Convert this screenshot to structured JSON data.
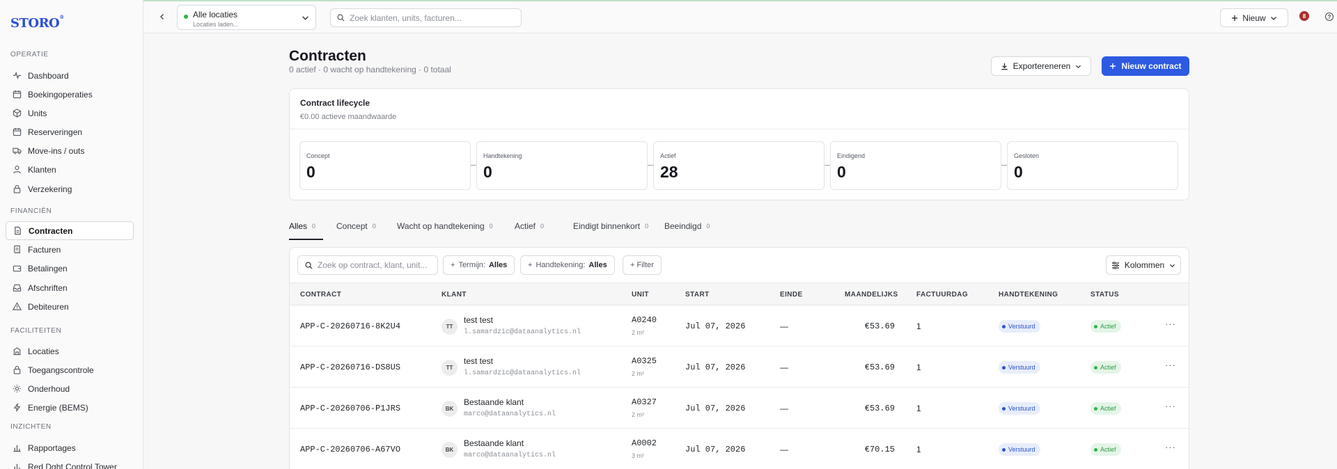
{
  "app": {
    "logo": "STORO",
    "logo_mark": "®"
  },
  "sidebar": {
    "sections": [
      {
        "title": "OPERATIE",
        "items": [
          {
            "label": "Dashboard",
            "icon": "activity-icon"
          },
          {
            "label": "Boekingoperaties",
            "icon": "calendar-icon"
          },
          {
            "label": "Units",
            "icon": "box-icon"
          },
          {
            "label": "Reserveringen",
            "icon": "calendar-icon"
          },
          {
            "label": "Move-ins / outs",
            "icon": "truck-icon"
          },
          {
            "label": "Klanten",
            "icon": "user-icon"
          },
          {
            "label": "Verzekering",
            "icon": "lock-icon"
          }
        ]
      },
      {
        "title": "FINANCIËN",
        "items": [
          {
            "label": "Contracten",
            "icon": "document-icon",
            "active": true
          },
          {
            "label": "Facturen",
            "icon": "receipt-icon"
          },
          {
            "label": "Betalingen",
            "icon": "wallet-icon"
          },
          {
            "label": "Afschriften",
            "icon": "inbox-icon"
          },
          {
            "label": "Debiteuren",
            "icon": "warning-icon"
          }
        ]
      },
      {
        "title": "FACILITEITEN",
        "items": [
          {
            "label": "Locaties",
            "icon": "building-icon"
          },
          {
            "label": "Toegangscontrole",
            "icon": "lock-icon"
          },
          {
            "label": "Onderhoud",
            "icon": "sun-icon"
          },
          {
            "label": "Energie (BEMS)",
            "icon": "bolt-icon"
          }
        ]
      },
      {
        "title": "INZICHTEN",
        "items": [
          {
            "label": "Rapportages",
            "icon": "chart-icon"
          },
          {
            "label": "Red Dght Control Tower",
            "icon": "chart-icon"
          }
        ]
      }
    ]
  },
  "topbar": {
    "location_title": "Alle locaties",
    "location_sub": "Locaties laden...",
    "search_placeholder": "Zoek klanten, units, facturen...",
    "new_label": "Nieuw",
    "notif_count": "8",
    "help": "?"
  },
  "header": {
    "title": "Contracten",
    "subtitle": "0 actief · 0 wacht op handtekening · 0 totaal",
    "export_label": "Exportereneren",
    "new_contract_label": "Nieuw contract"
  },
  "lifecycle": {
    "title": "Contract lifecycle",
    "subtitle": "€0.00 actieve maandwaarde",
    "stages": [
      {
        "label": "Concept",
        "value": "0"
      },
      {
        "label": "Handtekening",
        "value": "0"
      },
      {
        "label": "Actief",
        "value": "28"
      },
      {
        "label": "Eindigend",
        "value": "0"
      },
      {
        "label": "Gesloten",
        "value": "0"
      }
    ]
  },
  "tabs": [
    {
      "label": "Alles",
      "count": "0",
      "active": true
    },
    {
      "label": "Concept",
      "count": "0"
    },
    {
      "label": "Wacht op handtekening",
      "count": "0"
    },
    {
      "label": "Actief",
      "count": "0"
    },
    {
      "label": "Eindigt binnenkort",
      "count": "0"
    },
    {
      "label": "Beeindigd",
      "count": "0"
    }
  ],
  "filters": {
    "search_placeholder": "Zoek op contract, klant, unit...",
    "termijn_label": "Termijn:",
    "termijn_value": "Alles",
    "handtekening_label": "Handtekening:",
    "handtekening_value": "Alles",
    "add_filter": "+ Filter",
    "columns_label": "Kolommen"
  },
  "table": {
    "headers": [
      "CONTRACT",
      "KLANT",
      "UNIT",
      "START",
      "EINDE",
      "MAANDELIJKS",
      "FACTUURDAG",
      "HANDTEKENING",
      "STATUS"
    ],
    "rows": [
      {
        "contract": "APP-C-20260716-8K2U4",
        "initials": "TT",
        "name": "test test",
        "email": "l.samardzic@dataanalytics.nl",
        "unit": "A0240",
        "size": "2 m²",
        "start": "Jul 07, 2026",
        "end": "—",
        "monthly": "€53.69",
        "invoice_day": "1",
        "signature": "Verstuurd",
        "status": "Actief"
      },
      {
        "contract": "APP-C-20260716-DS8US",
        "initials": "TT",
        "name": "test test",
        "email": "l.samardzic@dataanalytics.nl",
        "unit": "A0325",
        "size": "2 m²",
        "start": "Jul 07, 2026",
        "end": "—",
        "monthly": "€53.69",
        "invoice_day": "1",
        "signature": "Verstuurd",
        "status": "Actief"
      },
      {
        "contract": "APP-C-20260706-P1JRS",
        "initials": "BK",
        "name": "Bestaande klant",
        "email": "marco@dataanalytics.nl",
        "unit": "A0327",
        "size": "2 m²",
        "start": "Jul 07, 2026",
        "end": "—",
        "monthly": "€53.69",
        "invoice_day": "1",
        "signature": "Verstuurd",
        "status": "Actief"
      },
      {
        "contract": "APP-C-20260706-A67VO",
        "initials": "BK",
        "name": "Bestaande klant",
        "email": "marco@dataanalytics.nl",
        "unit": "A0002",
        "size": "3 m²",
        "start": "Jul 07, 2026",
        "end": "—",
        "monthly": "€70.15",
        "invoice_day": "1",
        "signature": "Verstuurd",
        "status": "Actief"
      }
    ]
  },
  "colors": {
    "accent": "#2d5ae0",
    "brand": "#2b4fd7",
    "active_green": "#2fb344",
    "sent_blue": "#2c54c9"
  }
}
